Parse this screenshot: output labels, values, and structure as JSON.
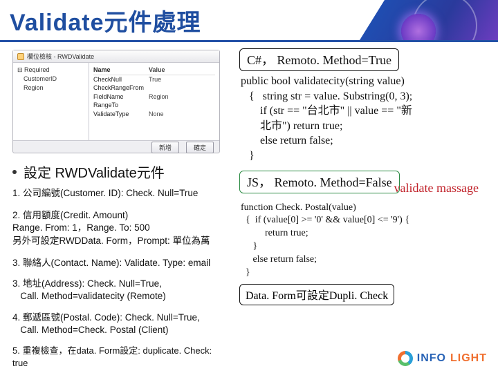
{
  "title": "Validate元件處理",
  "screenshot": {
    "windowTitle": "欄位檢核 - RWDValidate",
    "tree": [
      "⊟ Required",
      "　CustomerID",
      "　Region"
    ],
    "listHeader": {
      "c1": "Name",
      "c2": "Value"
    },
    "list": [
      {
        "c1": "CheckNull",
        "c2": "True"
      },
      {
        "c1": "CheckRangeFrom",
        "c2": ""
      },
      {
        "c1": "FieldName",
        "c2": "Region"
      },
      {
        "c1": "RangeTo",
        "c2": ""
      },
      {
        "c1": "ValidateType",
        "c2": "None"
      }
    ],
    "btnOk": "確定",
    "btnAdd": "新增"
  },
  "bullet_label": "設定 RWDValidate元件",
  "items": {
    "i1": "1. 公司編號(Customer. ID): Check. Null=True",
    "i2a": "2. 信用額度(Credit. Amount)",
    "i2b": "Range. From: 1，Range. To: 500",
    "i2c": "另外可設定RWDData. Form，Prompt: 單位為萬",
    "i3": "3. 聯絡人(Contact. Name): Validate. Type: email",
    "i3b_a": "3. 地址(Address): Check. Null=True,",
    "i3b_b": "   Call. Method=validatecity (Remote)",
    "i4a": "4. 郵遞區號(Postal. Code): Check. Null=True,",
    "i4b": "   Call. Method=Check. Postal (Client)",
    "i5": "5. 重複檢查，在data. Form設定: duplicate. Check: true"
  },
  "right": {
    "tag1": "C#， Remoto. Method=True",
    "code1": "public bool validatecity(string value)\n   {   string str = value. Substring(0, 3);\n       if (str == \"台北市\" || value == \"新\n       北市\") return true;\n       else return false;\n   }",
    "annot": "validate massage",
    "tag2": "JS， Remoto. Method=False",
    "code2": "function Check. Postal(value)\n  {  if (value[0] >= '0' && value[0] <= '9') {\n          return true;\n     }\n     else return false;\n  }",
    "footer": "Data. Form可設定Dupli. Check"
  },
  "logo": {
    "part1": "INFO",
    "part2": "LIGHT"
  }
}
